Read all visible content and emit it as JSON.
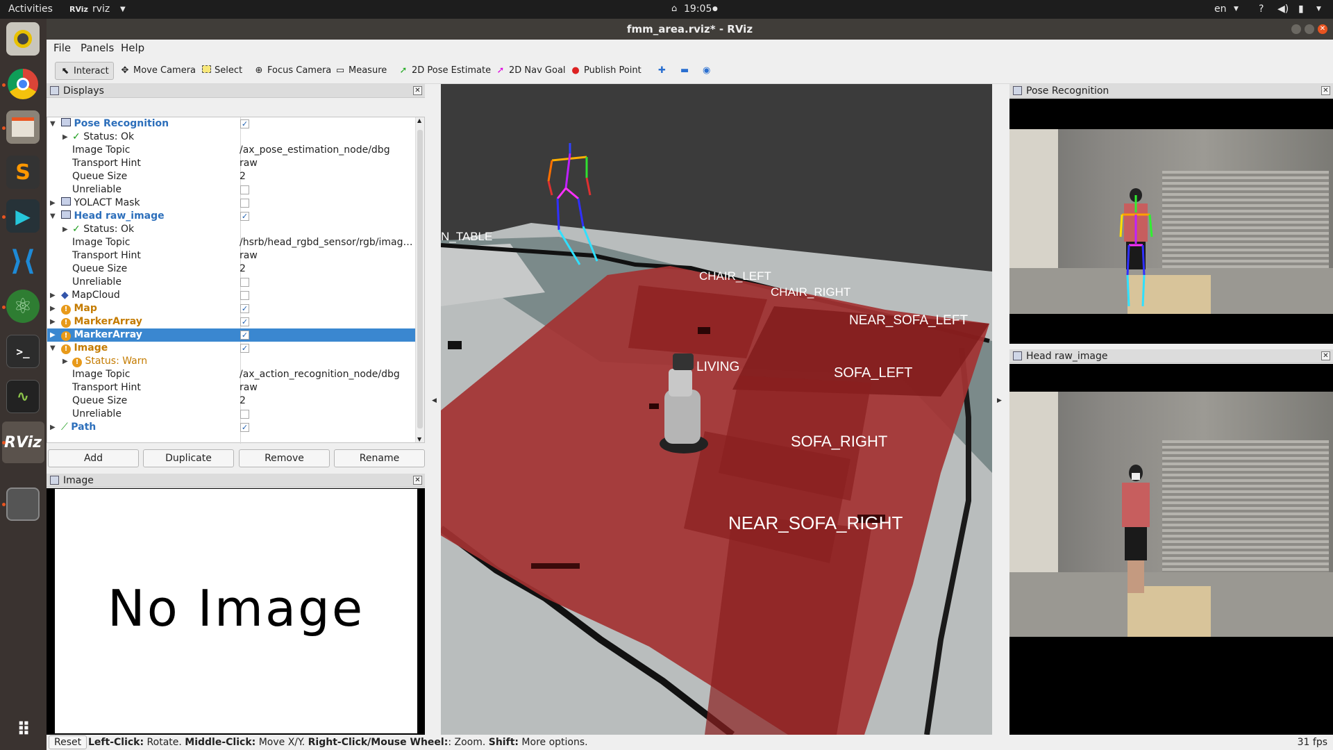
{
  "topbar": {
    "activities": "Activities",
    "app_name": "rviz",
    "clock": "19:05",
    "lang": "en"
  },
  "window": {
    "title": "fmm_area.rviz* - RViz"
  },
  "menu": {
    "file": "File",
    "panels": "Panels",
    "help": "Help"
  },
  "toolbar": {
    "interact": "Interact",
    "move_camera": "Move Camera",
    "select": "Select",
    "focus_camera": "Focus Camera",
    "measure": "Measure",
    "pose_estimate": "2D Pose Estimate",
    "nav_goal": "2D Nav Goal",
    "publish_point": "Publish Point"
  },
  "displays": {
    "title": "Displays",
    "rows": [
      {
        "name": "Pose Recognition",
        "checked": "✓"
      },
      {
        "name": "Status: Ok"
      },
      {
        "name": "Image Topic",
        "value": "/ax_pose_estimation_node/dbg"
      },
      {
        "name": "Transport Hint",
        "value": "raw"
      },
      {
        "name": "Queue Size",
        "value": "2"
      },
      {
        "name": "Unreliable"
      },
      {
        "name": "YOLACT Mask"
      },
      {
        "name": "Head raw_image",
        "checked": "✓"
      },
      {
        "name": "Status: Ok"
      },
      {
        "name": "Image Topic",
        "value": "/hsrb/head_rgbd_sensor/rgb/imag…"
      },
      {
        "name": "Transport Hint",
        "value": "raw"
      },
      {
        "name": "Queue Size",
        "value": "2"
      },
      {
        "name": "Unreliable"
      },
      {
        "name": "MapCloud"
      },
      {
        "name": "Map",
        "checked": "✓"
      },
      {
        "name": "MarkerArray",
        "checked": "✓"
      },
      {
        "name": "MarkerArray",
        "checked": "✓"
      },
      {
        "name": "Image",
        "checked": "✓"
      },
      {
        "name": "Status: Warn"
      },
      {
        "name": "Image Topic",
        "value": "/ax_action_recognition_node/dbg"
      },
      {
        "name": "Transport Hint",
        "value": "raw"
      },
      {
        "name": "Queue Size",
        "value": "2"
      },
      {
        "name": "Unreliable"
      },
      {
        "name": "Path",
        "checked": "✓"
      }
    ],
    "buttons": {
      "add": "Add",
      "duplicate": "Duplicate",
      "remove": "Remove",
      "rename": "Rename"
    }
  },
  "image_panel": {
    "title": "Image",
    "placeholder": "No Image"
  },
  "view3d": {
    "labels": {
      "table": "N_TABLE",
      "chair_left": "CHAIR_LEFT",
      "chair_right": "CHAIR_RIGHT",
      "near_sofa_left": "NEAR_SOFA_LEFT",
      "living": "LIVING",
      "sofa_left": "SOFA_LEFT",
      "sofa_right": "SOFA_RIGHT",
      "near_sofa_right": "NEAR_SOFA_RIGHT"
    }
  },
  "right_panels": {
    "pose_recognition": "Pose Recognition",
    "head_raw_image": "Head raw_image"
  },
  "statusbar": {
    "reset": "Reset",
    "left_click": "Left-Click:",
    "left_click_desc": " Rotate. ",
    "middle_click": "Middle-Click:",
    "middle_click_desc": " Move X/Y. ",
    "right_click": "Right-Click/Mouse Wheel:",
    "right_click_desc": ": Zoom. ",
    "shift": "Shift:",
    "shift_desc": " More options.",
    "fps": "31 fps"
  },
  "colors": {
    "accent": "#3a87d0",
    "warn": "#e89a1a",
    "zone": "#b02020"
  }
}
